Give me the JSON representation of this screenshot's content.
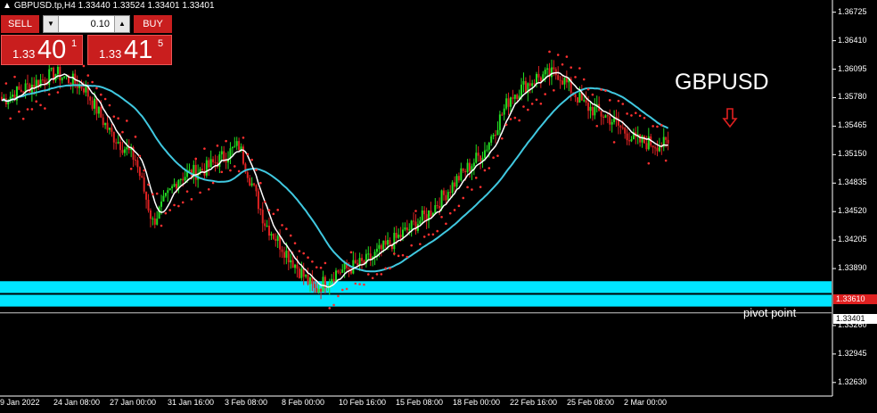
{
  "header": {
    "symbol_info": "GBPUSD.tp,H4  1.33440 1.33524 1.33401 1.33401"
  },
  "trade_panel": {
    "sell_label": "SELL",
    "buy_label": "BUY",
    "lot_value": "0.10",
    "sell_quote": {
      "prefix": "1.33",
      "big": "40",
      "sup": "1"
    },
    "buy_quote": {
      "prefix": "1.33",
      "big": "41",
      "sup": "5"
    }
  },
  "annotations": {
    "symbol_title": "GBPUSD",
    "pivot_label": "pivot point",
    "down_arrow_color": "#e02020"
  },
  "price_axis": {
    "labels": [
      "1.36725",
      "1.36410",
      "1.36095",
      "1.35780",
      "1.35465",
      "1.35150",
      "1.34835",
      "1.34520",
      "1.34205",
      "1.33890",
      "1.33260",
      "1.32945",
      "1.32630"
    ],
    "current_price": "1.33401",
    "red_tag": "1.33610"
  },
  "time_axis": {
    "labels": [
      "9 Jan 2022",
      "24 Jan 08:00",
      "27 Jan 00:00",
      "31 Jan 16:00",
      "3 Feb 08:00",
      "8 Feb 00:00",
      "10 Feb 16:00",
      "15 Feb 08:00",
      "18 Feb 00:00",
      "22 Feb 16:00",
      "25 Feb 08:00",
      "2 Mar 00:00"
    ]
  },
  "colors": {
    "bull": "#22dd22",
    "bear": "#dd2222",
    "zone": "#00e5ff",
    "ma_slow": "#40c8e0",
    "ma_fast": "#ffffff",
    "sar": "#ff3030"
  },
  "chart_data": {
    "type": "candlestick",
    "ylim": [
      1.3248,
      1.3686
    ],
    "x_count": 310,
    "zone": {
      "top": 1.3375,
      "bottom": 1.3347,
      "split": 1.3361
    },
    "pivot_level": 1.334,
    "waypoints": [
      [
        0,
        1.3575
      ],
      [
        12,
        1.359
      ],
      [
        25,
        1.3605
      ],
      [
        38,
        1.359
      ],
      [
        50,
        1.354
      ],
      [
        62,
        1.351
      ],
      [
        70,
        1.344
      ],
      [
        82,
        1.349
      ],
      [
        95,
        1.35
      ],
      [
        110,
        1.3525
      ],
      [
        122,
        1.344
      ],
      [
        134,
        1.34
      ],
      [
        145,
        1.3365
      ],
      [
        155,
        1.3385
      ],
      [
        168,
        1.3395
      ],
      [
        182,
        1.342
      ],
      [
        198,
        1.345
      ],
      [
        212,
        1.349
      ],
      [
        224,
        1.352
      ],
      [
        236,
        1.358
      ],
      [
        248,
        1.36
      ],
      [
        258,
        1.3605
      ],
      [
        270,
        1.357
      ],
      [
        282,
        1.3555
      ],
      [
        294,
        1.353
      ],
      [
        310,
        1.3525
      ]
    ]
  }
}
